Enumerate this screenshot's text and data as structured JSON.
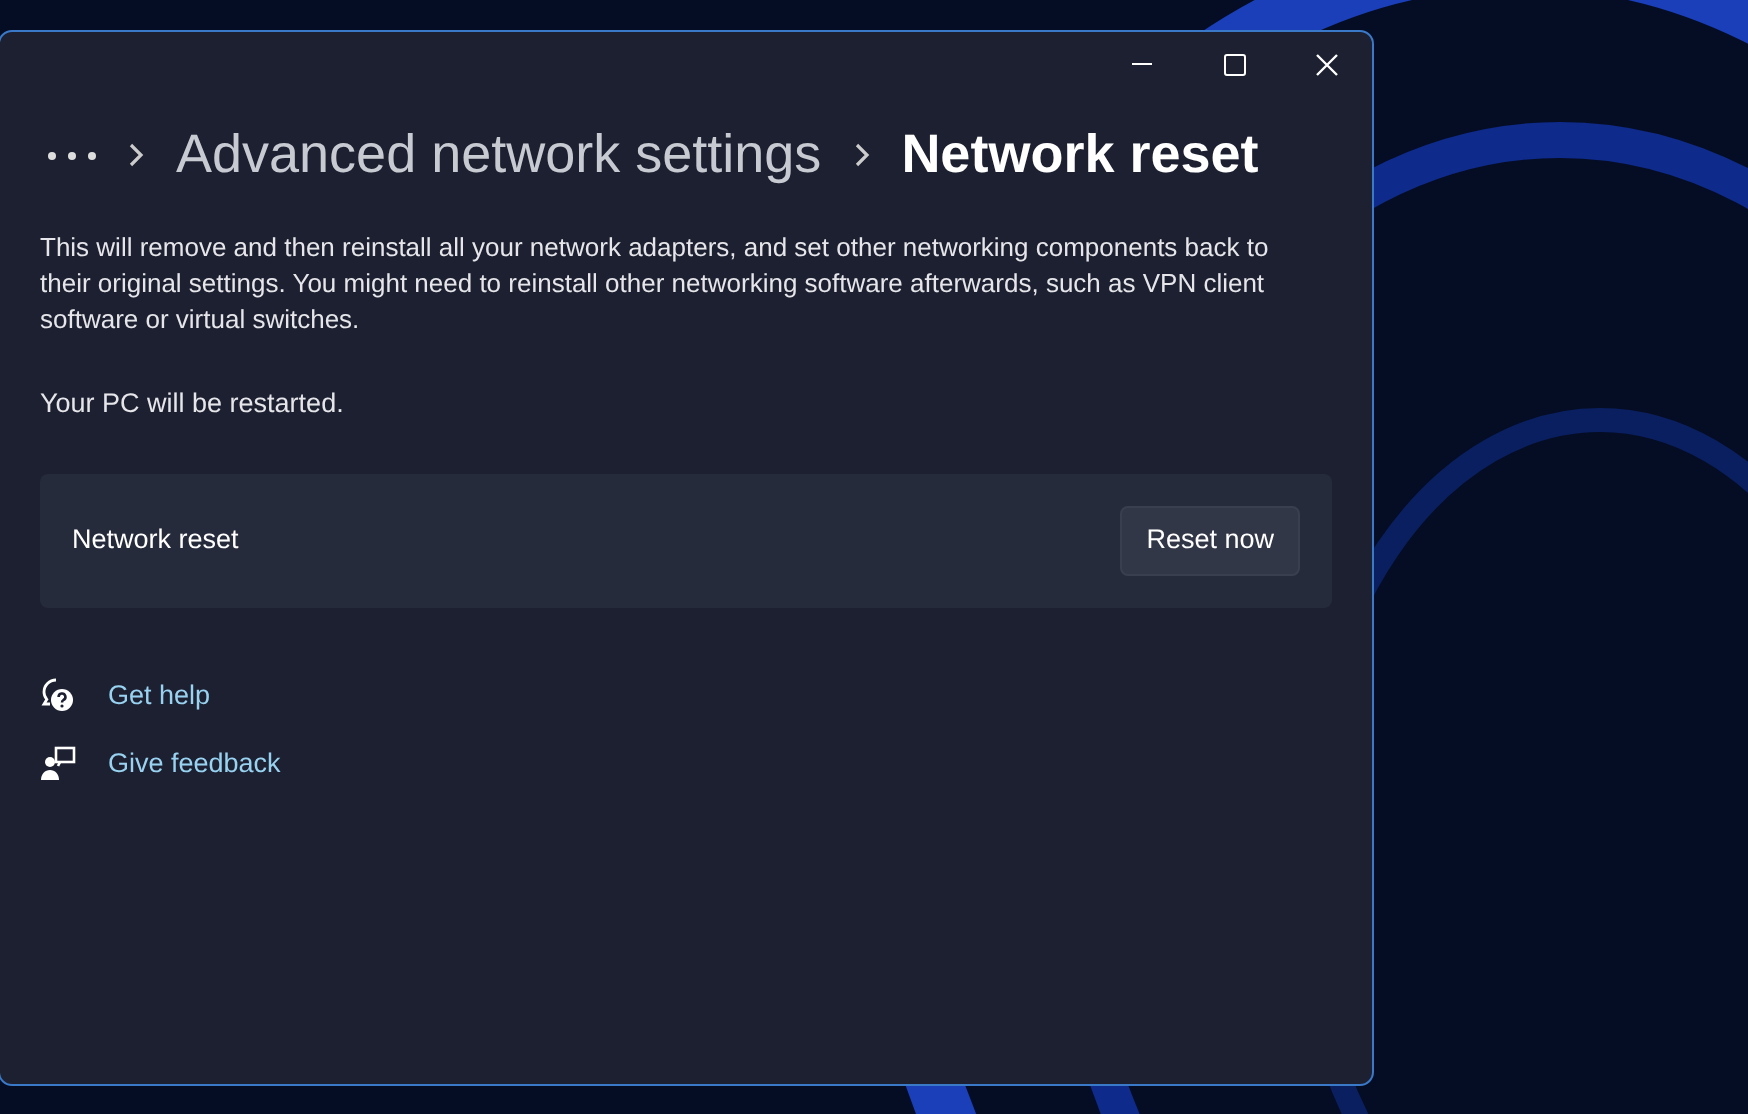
{
  "breadcrumb": [
    {
      "label": "Advanced network settings",
      "current": false
    },
    {
      "label": "Network reset",
      "current": true
    }
  ],
  "description": "This will remove and then reinstall all your network adapters, and set other networking components back to their original settings. You might need to reinstall other networking software afterwards, such as VPN client software or virtual switches.",
  "note": "Your PC will be restarted.",
  "setting_card": {
    "label": "Network reset",
    "button": "Reset now"
  },
  "links": [
    {
      "kind": "help",
      "label": "Get help"
    },
    {
      "kind": "feedback",
      "label": "Give feedback"
    }
  ]
}
